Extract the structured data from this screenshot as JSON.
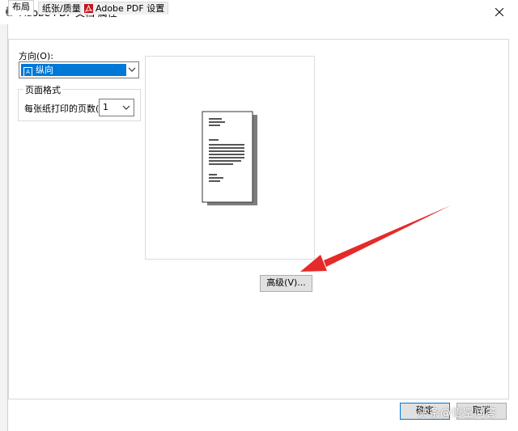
{
  "window": {
    "title": "Adobe PDF 文档 属性"
  },
  "tabs": [
    {
      "label": "布局",
      "active": true
    },
    {
      "label": "纸张/质量",
      "active": false
    },
    {
      "label": "Adobe PDF 设置",
      "active": false
    }
  ],
  "orientation": {
    "label": "方向(O):",
    "selected": "纵向",
    "icon": "portrait-page-icon"
  },
  "page_format": {
    "legend": "页面格式",
    "pages_per_sheet_label": "每张纸打印的页数(S)",
    "pages_per_sheet_value": "1"
  },
  "buttons": {
    "advanced": "高级(V)...",
    "ok": "确定",
    "cancel": "取消"
  },
  "watermark": {
    "text": "头条@悟空问答"
  },
  "colors": {
    "accent": "#0078d7",
    "arrow": "#e52a2a",
    "pdf_red": "#c4161c"
  }
}
